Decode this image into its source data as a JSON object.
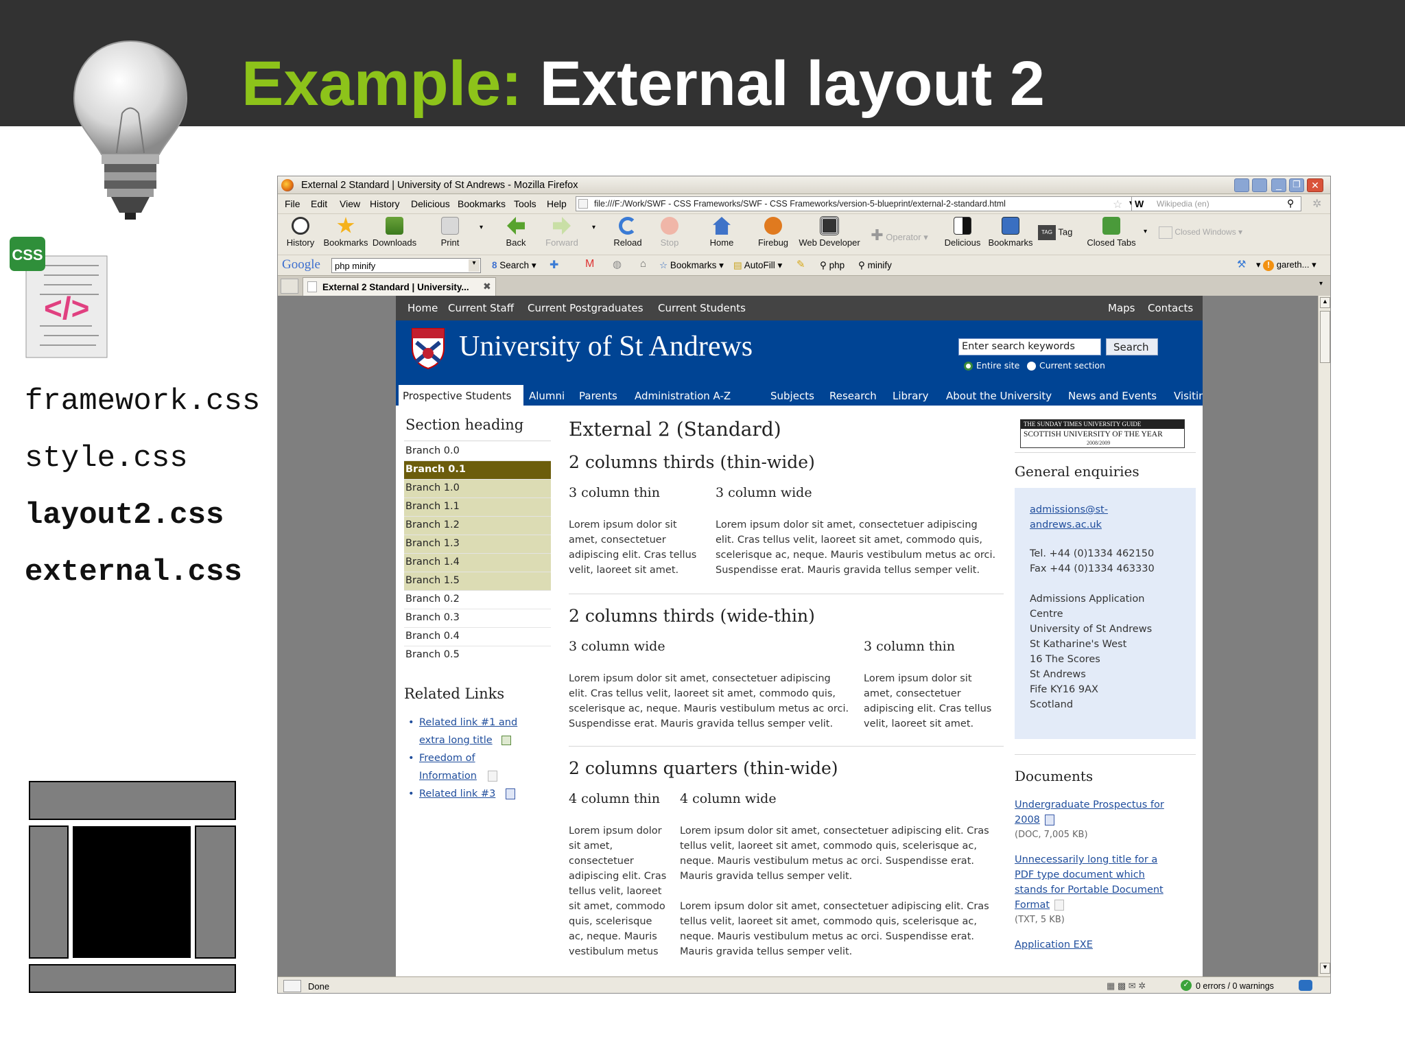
{
  "slide": {
    "title_a": "Example:",
    "title_b": "External layout 2",
    "files": [
      "framework.css",
      "style.css",
      "layout2.css",
      "external.css"
    ],
    "css_badge": "CSS"
  },
  "browser": {
    "window_title": "External 2 Standard | University of St Andrews - Mozilla Firefox",
    "menu": [
      "File",
      "Edit",
      "View",
      "History",
      "Delicious",
      "Bookmarks",
      "Tools",
      "Help"
    ],
    "url": "file:///F:/Work/SWF - CSS Frameworks/SWF - CSS Frameworks/version-5-blueprint/external-2-standard.html",
    "search_engine": "W",
    "search_placeholder": "Wikipedia (en)",
    "toolbar": [
      "History",
      "Bookmarks",
      "Downloads",
      "Print",
      "Back",
      "Forward",
      "Reload",
      "Stop",
      "Home",
      "Firebug",
      "Web Developer",
      "Operator",
      "Delicious",
      "Bookmarks",
      "Tag",
      "Closed Tabs",
      "Closed Windows"
    ],
    "google_label": "Google",
    "google_query": "php minify",
    "gbar": {
      "search": "Search",
      "bookmarks": "Bookmarks",
      "autofill": "AutoFill",
      "php": "php",
      "minify": "minify",
      "user": "gareth..."
    },
    "tab_title": "External 2 Standard | University...",
    "status": "Done",
    "status_right": "0 errors / 0 warnings"
  },
  "site": {
    "topnav_left": [
      "Home",
      "Current Staff",
      "Current Postgraduates",
      "Current Students"
    ],
    "topnav_right": [
      "Maps",
      "Contacts"
    ],
    "university": "University of St Andrews",
    "search_placeholder": "Enter search keywords",
    "search_button": "Search",
    "radio_entire": "Entire site",
    "radio_section": "Current section",
    "tabs": [
      "Prospective Students",
      "Alumni",
      "Parents",
      "Administration A-Z",
      "Subjects",
      "Research",
      "Library",
      "About the University",
      "News and Events",
      "Visiting"
    ],
    "section_heading": "Section heading",
    "branches": [
      "Branch 0.0",
      "Branch 0.1",
      "Branch 1.0",
      "Branch 1.1",
      "Branch 1.2",
      "Branch 1.3",
      "Branch 1.4",
      "Branch 1.5",
      "Branch 0.2",
      "Branch 0.3",
      "Branch 0.4",
      "Branch 0.5"
    ],
    "related_heading": "Related Links",
    "related": {
      "l1a": "Related link #1 and",
      "l1b": "extra long title",
      "l2a": "Freedom of",
      "l2b": "Information",
      "l3": "Related link #3"
    },
    "main": {
      "title": "External 2 (Standard)",
      "s1": "2 columns thirds (thin-wide)",
      "s1_thin": "3 column thin",
      "s1_wide": "3 column wide",
      "thin_lines": [
        "Lorem ipsum dolor sit",
        "amet, consectetuer",
        "adipiscing elit. Cras tellus",
        "velit, laoreet sit amet."
      ],
      "wide_lines": [
        "Lorem ipsum dolor sit amet, consectetuer adipiscing",
        "elit. Cras tellus velit, laoreet sit amet, commodo quis,",
        "scelerisque ac, neque. Mauris vestibulum metus ac orci.",
        "Suspendisse erat. Mauris gravida tellus semper velit."
      ],
      "s2": "2 columns thirds (wide-thin)",
      "s2_wide": "3 column wide",
      "s2_thin": "3 column thin",
      "s2_thin_lines": [
        "Lorem ipsum dolor sit",
        "amet, consectetuer",
        "adipiscing elit. Cras tellus",
        "velit, laoreet sit amet."
      ],
      "s3": "2 columns quarters (thin-wide)",
      "s3_thin": "4 column thin",
      "s3_wide": "4 column wide",
      "q_thin_lines": [
        "Lorem ipsum dolor",
        "sit amet,",
        "consectetuer",
        "adipiscing elit. Cras",
        "tellus velit, laoreet",
        "sit amet, commodo",
        "quis, scelerisque",
        "ac, neque. Mauris",
        "vestibulum metus"
      ],
      "q_wide1": [
        "Lorem ipsum dolor sit amet, consectetuer adipiscing elit. Cras",
        "tellus velit, laoreet sit amet, commodo quis, scelerisque ac,",
        "neque. Mauris vestibulum metus ac orci. Suspendisse erat.",
        "Mauris gravida tellus semper velit."
      ],
      "q_wide2": [
        "Lorem ipsum dolor sit amet, consectetuer adipiscing elit. Cras",
        "tellus velit, laoreet sit amet, commodo quis, scelerisque ac,",
        "neque. Mauris vestibulum metus ac orci. Suspendisse erat.",
        "Mauris gravida tellus semper velit."
      ]
    },
    "right": {
      "award_l1": "THE SUNDAY TIMES UNIVERSITY GUIDE",
      "award_l2": "SCOTTISH UNIVERSITY OF THE YEAR",
      "award_l3": "2008/2009",
      "enquiries": "General enquiries",
      "email_a": "admissions@st-",
      "email_b": "andrews.ac.uk",
      "tel": "Tel. +44 (0)1334 462150",
      "fax": "Fax +44 (0)1334 463330",
      "address": [
        "Admissions Application",
        "Centre",
        "University of St Andrews",
        "St Katharine's West",
        "16 The Scores",
        "St Andrews",
        "Fife KY16 9AX",
        "Scotland"
      ],
      "documents": "Documents",
      "doc1a": "Undergraduate Prospectus for",
      "doc1b": "2008",
      "doc1_meta": "(DOC, 7,005 KB)",
      "doc2": [
        "Unnecessarily long title for a",
        "PDF type document which",
        "stands for Portable Document",
        "Format"
      ],
      "doc2_meta": "(TXT, 5 KB)",
      "doc3": "Application EXE"
    }
  },
  "colors": {
    "green": "#8dc31a",
    "dark": "#323232",
    "navy": "#004494",
    "olive": "#6c5d0c",
    "pale": "#dcdcb4"
  }
}
